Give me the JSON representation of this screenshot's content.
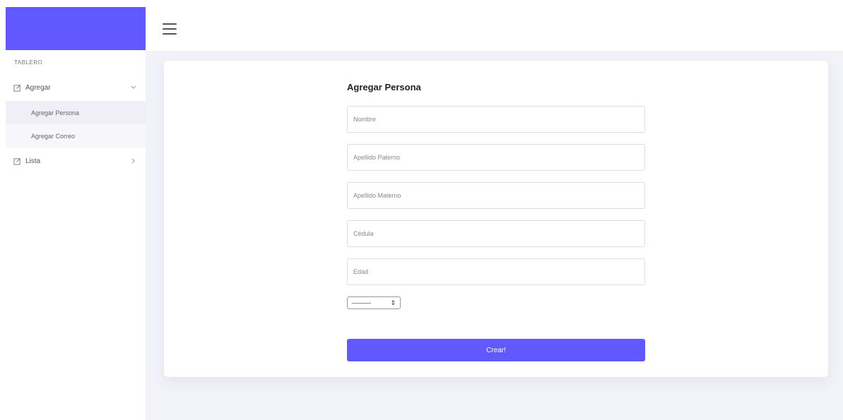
{
  "colors": {
    "brand": "#6158fe",
    "content_bg": "#f2f2f9",
    "card_bg": "#ffffff"
  },
  "sidebar": {
    "section_label": "TABLERO",
    "items": [
      {
        "label": "Agregar",
        "icon": "edit-icon",
        "expanded": true,
        "chevron": "chevron-down-icon",
        "subitems": [
          {
            "label": "Agregar Persona",
            "active": true
          },
          {
            "label": "Agregar Correo",
            "active": false
          }
        ]
      },
      {
        "label": "Lista",
        "icon": "edit-icon",
        "expanded": false,
        "chevron": "chevron-right-icon"
      }
    ]
  },
  "header": {
    "menu_icon": "hamburger-icon"
  },
  "form": {
    "title": "Agregar Persona",
    "fields": {
      "nombre": {
        "placeholder": "Nombre"
      },
      "apellido_paterno": {
        "placeholder": "Apellido Paterno"
      },
      "apellido_materno": {
        "placeholder": "Apellido Materno"
      },
      "cedula": {
        "placeholder": "Cédula"
      },
      "edad": {
        "placeholder": "Edad"
      }
    },
    "select": {
      "selected": "———"
    },
    "submit_label": "Crear!"
  }
}
